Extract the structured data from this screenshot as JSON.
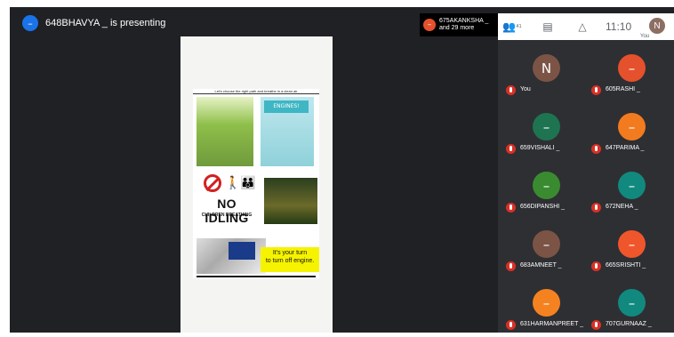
{
  "presenting_banner": {
    "avatar": "–",
    "text": "648BHAVYA _ is presenting"
  },
  "presenter_chip": {
    "line1": "675AKANKSHA _",
    "line2": "and 29 more",
    "avatar": "–"
  },
  "sidebar_header": {
    "people_icon": "people-icon",
    "people_count": "41",
    "chat_icon": "chat-icon",
    "activities_icon": "activities-icon",
    "time": "11:10",
    "user_avatar": "N",
    "user_label": "You"
  },
  "poster": {
    "title": "Let's choose the right path and breathe in a clean air",
    "panel_heading": "ENGINES!",
    "no_idling": "NO IDLING",
    "children_breathing": "CHILDREN BREATHING",
    "turn_text": "It's your turn\nto turn off engine."
  },
  "participants": [
    {
      "initial": "N",
      "name": "You",
      "color": "#7b5446"
    },
    {
      "initial": "–",
      "name": "605RASHI _",
      "color": "#e4512c"
    },
    {
      "initial": "–",
      "name": "659VISHALI _",
      "color": "#1e7450"
    },
    {
      "initial": "–",
      "name": "647PARIMA _",
      "color": "#f37b1f"
    },
    {
      "initial": "–",
      "name": "656DIPANSHI _",
      "color": "#3a8b30"
    },
    {
      "initial": "–",
      "name": "672NEHA _",
      "color": "#11897e"
    },
    {
      "initial": "–",
      "name": "683AMNEET _",
      "color": "#7b5446"
    },
    {
      "initial": "–",
      "name": "665SRISHTI _",
      "color": "#f0562b"
    },
    {
      "initial": "–",
      "name": "631HARMANPREET _",
      "color": "#f58220"
    },
    {
      "initial": "–",
      "name": "707GURNAAZ _",
      "color": "#11897e"
    }
  ],
  "colors": {
    "background": "#202124",
    "grid": "#2e2f33",
    "mic_off": "#d93025",
    "presenter_blue": "#1a73e8"
  }
}
